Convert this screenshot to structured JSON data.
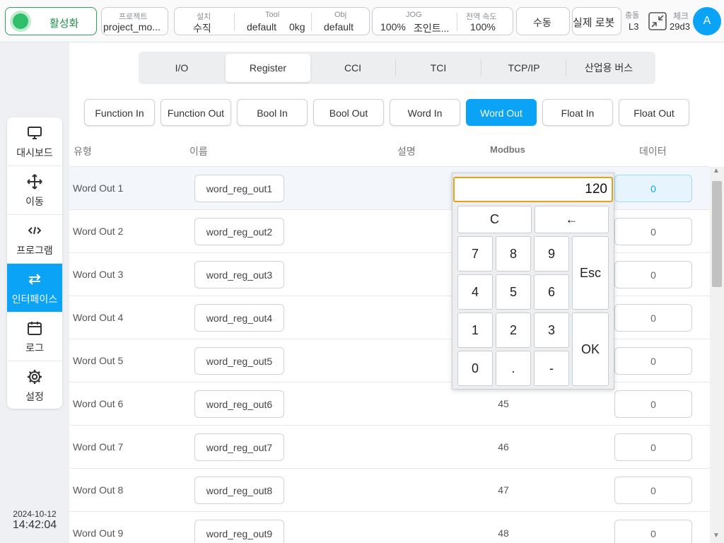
{
  "topbar": {
    "activate_label": "활성화",
    "project_label": "프로젝트",
    "project_value": "project_mo...",
    "install_label": "설치",
    "install_value": "수직",
    "tool_label": "Tool",
    "tool_value": "default",
    "tool_weight": "0kg",
    "obj_label": "Obj",
    "obj_value": "default",
    "jog_label": "JOG",
    "jog_value": "100%",
    "jog_mode": "조인트...",
    "speed_label": "전역 속도",
    "speed_value": "100%",
    "manual_label": "수동",
    "real_robot_label": "실제 로봇",
    "collision_label": "충돌",
    "collision_value": "L3",
    "check_label": "체크",
    "check_value": "29d3",
    "avatar_letter": "A"
  },
  "sidebar": {
    "items": [
      {
        "label": "대시보드",
        "icon": "monitor-icon"
      },
      {
        "label": "이동",
        "icon": "move-icon"
      },
      {
        "label": "프로그램",
        "icon": "code-icon"
      },
      {
        "label": "인터페이스",
        "icon": "swap-icon"
      },
      {
        "label": "로그",
        "icon": "calendar-icon"
      },
      {
        "label": "설정",
        "icon": "gear-icon"
      }
    ],
    "active_index": 3,
    "date": "2024-10-12",
    "time": "14:42:04"
  },
  "tabs": [
    "I/O",
    "Register",
    "CCI",
    "TCI",
    "TCP/IP",
    "산업용 버스"
  ],
  "active_tab": "Register",
  "subtabs": [
    "Function In",
    "Function Out",
    "Bool In",
    "Bool Out",
    "Word In",
    "Word Out",
    "Float In",
    "Float Out"
  ],
  "active_subtab": "Word Out",
  "table": {
    "headers": {
      "type": "유형",
      "name": "이름",
      "description": "설명",
      "modbus": "Modbus",
      "data": "데이터"
    },
    "rows": [
      {
        "type": "Word Out 1",
        "name": "word_reg_out1",
        "modbus": "",
        "value": "0"
      },
      {
        "type": "Word Out 2",
        "name": "word_reg_out2",
        "modbus": "",
        "value": "0"
      },
      {
        "type": "Word Out 3",
        "name": "word_reg_out3",
        "modbus": "",
        "value": "0"
      },
      {
        "type": "Word Out 4",
        "name": "word_reg_out4",
        "modbus": "",
        "value": "0"
      },
      {
        "type": "Word Out 5",
        "name": "word_reg_out5",
        "modbus": "",
        "value": "0"
      },
      {
        "type": "Word Out 6",
        "name": "word_reg_out6",
        "modbus": "45",
        "value": "0"
      },
      {
        "type": "Word Out 7",
        "name": "word_reg_out7",
        "modbus": "46",
        "value": "0"
      },
      {
        "type": "Word Out 8",
        "name": "word_reg_out8",
        "modbus": "47",
        "value": "0"
      },
      {
        "type": "Word Out 9",
        "name": "word_reg_out9",
        "modbus": "48",
        "value": "0"
      }
    ]
  },
  "keypad": {
    "display": "120",
    "clear": "C",
    "backspace": "←",
    "escape": "Esc",
    "ok": "OK",
    "digits": [
      "7",
      "8",
      "9",
      "4",
      "5",
      "6",
      "1",
      "2",
      "3",
      "0",
      ".",
      "-"
    ]
  },
  "colors": {
    "accent": "#0aa3f5",
    "active_green": "#2fbf6a",
    "display_border": "#e0a21a"
  }
}
